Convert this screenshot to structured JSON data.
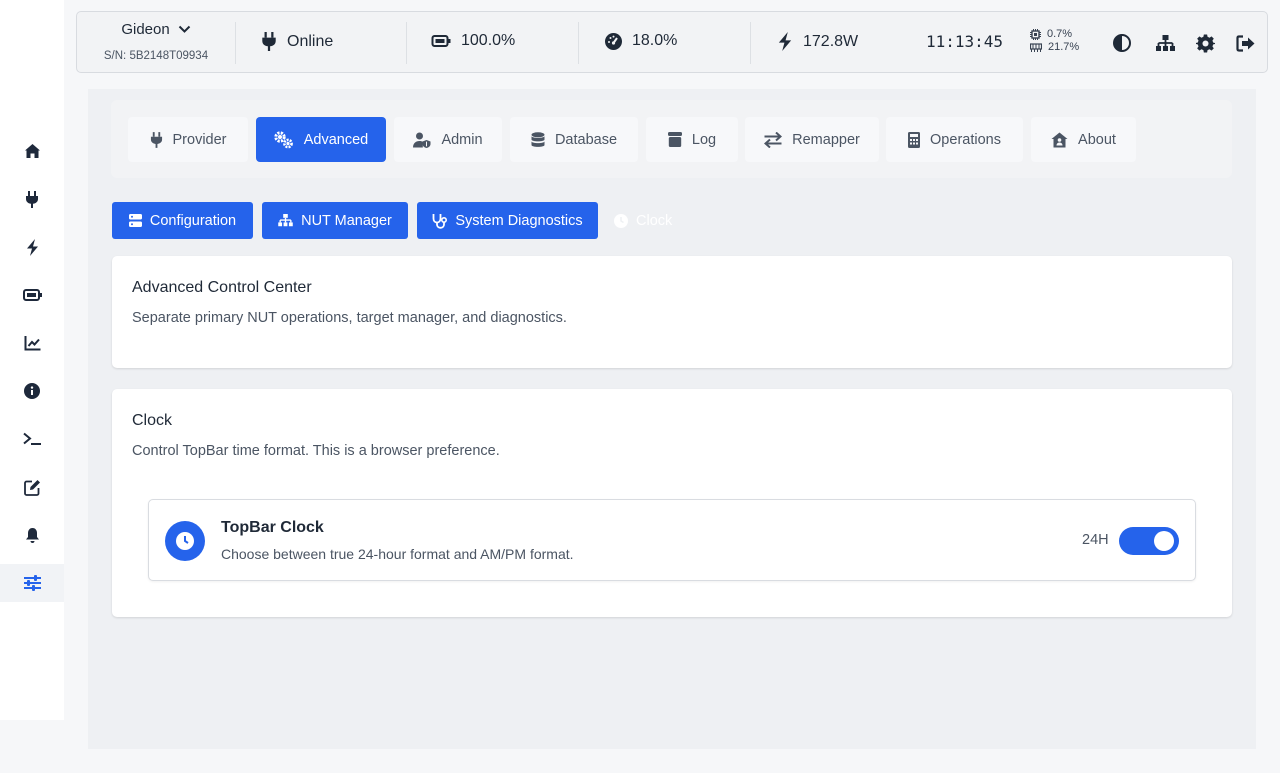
{
  "topbar": {
    "device_name": "Gideon",
    "serial": "S/N: 5B2148T09934",
    "status": "Online",
    "battery": "100.0%",
    "load": "18.0%",
    "power": "172.8W",
    "clock": "11:13:45",
    "cpu": "0.7%",
    "memory": "21.7%"
  },
  "sidebar": {
    "items": [
      {
        "icon": "home-icon"
      },
      {
        "icon": "plug-icon"
      },
      {
        "icon": "bolt-icon"
      },
      {
        "icon": "battery-icon"
      },
      {
        "icon": "chart-line-icon"
      },
      {
        "icon": "info-icon"
      },
      {
        "icon": "terminal-icon"
      },
      {
        "icon": "edit-icon"
      },
      {
        "icon": "bell-icon"
      },
      {
        "icon": "sliders-icon",
        "active": true
      }
    ]
  },
  "tabs": [
    {
      "label": "Provider",
      "icon": "plug-icon"
    },
    {
      "label": "Advanced",
      "icon": "gears-icon",
      "active": true
    },
    {
      "label": "Admin",
      "icon": "user-shield-icon"
    },
    {
      "label": "Database",
      "icon": "database-icon"
    },
    {
      "label": "Log",
      "icon": "archive-icon"
    },
    {
      "label": "Remapper",
      "icon": "arrows-icon"
    },
    {
      "label": "Operations",
      "icon": "calculator-icon"
    },
    {
      "label": "About",
      "icon": "house-user-icon"
    }
  ],
  "subtabs": [
    {
      "label": "Configuration",
      "icon": "server-icon"
    },
    {
      "label": "NUT Manager",
      "icon": "network-icon"
    },
    {
      "label": "System Diagnostics",
      "icon": "stethoscope-icon"
    },
    {
      "label": "Clock",
      "icon": "clock-icon"
    }
  ],
  "cards": {
    "advanced": {
      "title": "Advanced Control Center",
      "description": "Separate primary NUT operations, target manager, and diagnostics."
    },
    "clock": {
      "title": "Clock",
      "description": "Control TopBar time format. This is a browser preference.",
      "setting": {
        "title": "TopBar Clock",
        "description": "Choose between true 24-hour format and AM/PM format.",
        "value": "24H",
        "enabled": true
      }
    }
  },
  "colors": {
    "accent": "#2563eb",
    "background": "#eef0f3"
  }
}
